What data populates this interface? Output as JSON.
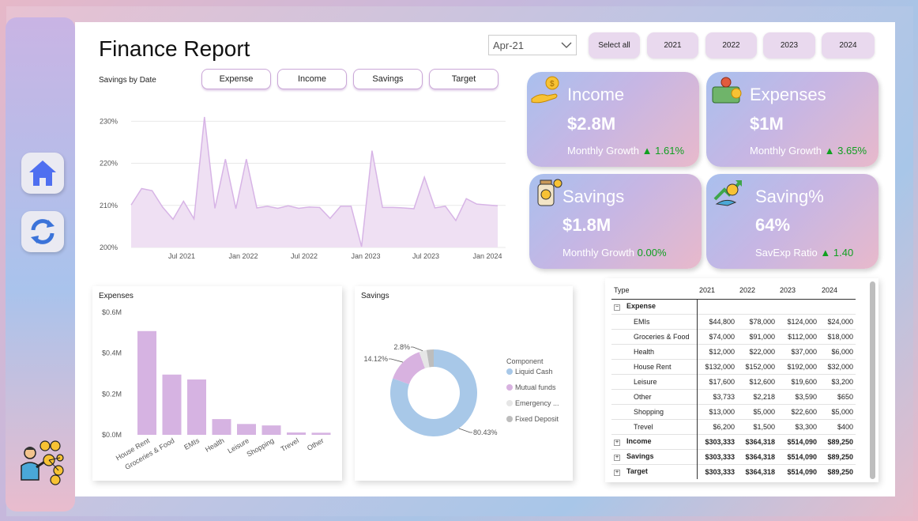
{
  "page": {
    "title": "Finance Report"
  },
  "filters": {
    "date_value": "Apr-21",
    "years": [
      "Select all",
      "2021",
      "2022",
      "2023",
      "2024"
    ]
  },
  "savings_by_date": {
    "title": "Savings by Date",
    "tabs": [
      "Expense",
      "Income",
      "Savings",
      "Target"
    ]
  },
  "kpis": [
    {
      "label": "Income",
      "value": "$2.8M",
      "growth_label": "Monthly Growth",
      "growth_arrow": "▲",
      "growth_value": "1.61%",
      "icon": "money-hand-icon"
    },
    {
      "label": "Expenses",
      "value": "$1M",
      "growth_label": "Monthly Growth",
      "growth_arrow": "▲",
      "growth_value": "3.65%",
      "icon": "wallet-icon"
    },
    {
      "label": "Savings",
      "value": "$1.8M",
      "growth_label": "Monthly Growth",
      "growth_arrow": "",
      "growth_value": "0.00%",
      "icon": "money-jar-icon"
    },
    {
      "label": "Saving%",
      "value": "64%",
      "growth_label": "SavExp Ratio",
      "growth_arrow": "▲",
      "growth_value": "1.40",
      "icon": "savings-growth-icon"
    }
  ],
  "matrix": {
    "headers": [
      "Type",
      "2021",
      "2022",
      "2023",
      "2024"
    ],
    "rows": [
      {
        "label": "Expense",
        "level": 0,
        "expand": "−",
        "values": [
          "",
          "",
          "",
          ""
        ]
      },
      {
        "label": "EMIs",
        "level": 1,
        "values": [
          "$44,800",
          "$78,000",
          "$124,000",
          "$24,000"
        ]
      },
      {
        "label": "Groceries & Food",
        "level": 1,
        "values": [
          "$74,000",
          "$91,000",
          "$112,000",
          "$18,000"
        ]
      },
      {
        "label": "Health",
        "level": 1,
        "values": [
          "$12,000",
          "$22,000",
          "$37,000",
          "$6,000"
        ]
      },
      {
        "label": "House Rent",
        "level": 1,
        "values": [
          "$132,000",
          "$152,000",
          "$192,000",
          "$32,000"
        ]
      },
      {
        "label": "Leisure",
        "level": 1,
        "values": [
          "$17,600",
          "$12,600",
          "$19,600",
          "$3,200"
        ]
      },
      {
        "label": "Other",
        "level": 1,
        "values": [
          "$3,733",
          "$2,218",
          "$3,590",
          "$650"
        ]
      },
      {
        "label": "Shopping",
        "level": 1,
        "values": [
          "$13,000",
          "$5,000",
          "$22,600",
          "$5,000"
        ]
      },
      {
        "label": "Trevel",
        "level": 1,
        "values": [
          "$6,200",
          "$1,500",
          "$3,300",
          "$400"
        ]
      },
      {
        "label": "Income",
        "level": 0,
        "expand": "+",
        "values": [
          "$303,333",
          "$364,318",
          "$514,090",
          "$89,250"
        ]
      },
      {
        "label": "Savings",
        "level": 0,
        "expand": "+",
        "values": [
          "$303,333",
          "$364,318",
          "$514,090",
          "$89,250"
        ]
      },
      {
        "label": "Target",
        "level": 0,
        "expand": "+",
        "values": [
          "$303,333",
          "$364,318",
          "$514,090",
          "$89,250"
        ]
      }
    ]
  },
  "colors": {
    "accent_purple": "#d6b3e2",
    "line_purple": "#d7b4e6",
    "donut_blue": "#a8c8e8",
    "donut_purple": "#d8b2e0",
    "growth_green": "#10a020"
  },
  "chart_data": [
    {
      "type": "area",
      "title": "Savings by Date",
      "x_ticks": [
        "Jul 2021",
        "Jan 2022",
        "Jul 2022",
        "Jan 2023",
        "Jul 2023",
        "Jan 2024"
      ],
      "y_ticks": [
        "200%",
        "210%",
        "220%",
        "230%"
      ],
      "ylim": [
        200,
        231
      ],
      "y": [
        210.1,
        214,
        213.5,
        209.6,
        206.7,
        211,
        206.8,
        231,
        209.3,
        221,
        209.2,
        221,
        209.4,
        209.8,
        209.3,
        209.9,
        209.3,
        209.6,
        209.5,
        206.9,
        209.8,
        209.8,
        200.2,
        223,
        209.5,
        209.5,
        209.4,
        209.2,
        216.7,
        209.4,
        209.8,
        206.4,
        211.6,
        210.3,
        210.1,
        209.9
      ]
    },
    {
      "type": "bar",
      "title": "Expenses",
      "categories": [
        "House Rent",
        "Groceries & Food",
        "EMIs",
        "Health",
        "Leisure",
        "Shopping",
        "Trevel",
        "Other"
      ],
      "values": [
        0.508,
        0.295,
        0.271,
        0.077,
        0.053,
        0.046,
        0.0114,
        0.0102
      ],
      "y_ticks": [
        "$0.0M",
        "$0.2M",
        "$0.4M",
        "$0.6M"
      ],
      "ylim": [
        0,
        0.6
      ]
    },
    {
      "type": "pie",
      "title": "Savings",
      "legend_title": "Component",
      "labels": [
        "Liquid Cash",
        "Mutual funds",
        "Emergency ...",
        "Fixed Deposit"
      ],
      "values": [
        80.43,
        14.12,
        2.8,
        2.65
      ],
      "value_labels": [
        "80.43%",
        "14.12%",
        "2.8%",
        ""
      ],
      "colors": [
        "#a8c8e8",
        "#d8b2e0",
        "#e6e6e6",
        "#bdbdbd"
      ]
    }
  ]
}
